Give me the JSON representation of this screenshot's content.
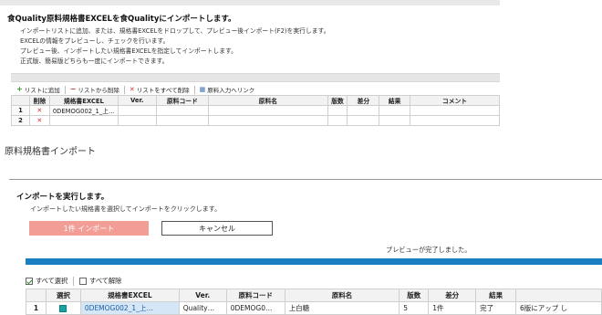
{
  "top_panel": {
    "title": "食Quality原料規格書EXCELを食Qualityにインポートします。",
    "instructions": [
      "インポートリストに追加、または、規格書EXCELをドロップして、プレビュー後インポート(F2)を実行します。",
      "EXCELの情報をプレビューし、チェックを行います。",
      "プレビュー後、インポートしたい規格書EXCELを指定してインポートします。",
      "正式版、簡易版どちらも一度にインポートできます。"
    ],
    "toolbar": {
      "add_label": "リストに追加",
      "remove_label": "リストから削除",
      "remove_all_label": "リストをすべて削除",
      "link_label": "原料入力へリンク"
    },
    "grid": {
      "columns": [
        "削除",
        "規格書EXCEL",
        "Ver.",
        "原料コード",
        "原料名",
        "版数",
        "差分",
        "結果",
        "コメント"
      ],
      "rows": [
        {
          "row_no": "1",
          "delete_mark": "✕",
          "file": "0DEMOG002_1_上…",
          "ver": "",
          "code": "",
          "name": "",
          "edition": "",
          "diff": "",
          "result": "",
          "comment": ""
        },
        {
          "row_no": "2",
          "delete_mark": "✕",
          "file": "",
          "ver": "",
          "code": "",
          "name": "",
          "edition": "",
          "diff": "",
          "result": "",
          "comment": ""
        }
      ]
    }
  },
  "section_title": "原料規格書インポート",
  "bottom_panel": {
    "title": "インポートを実行します。",
    "subtitle": "インポートしたい規格書を選択してインポートをクリックします。",
    "import_button": "1件 インポート",
    "cancel_button": "キャンセル",
    "preview_status": "プレビューが完了しました。",
    "toolbar": {
      "select_all_label": "すべて選択",
      "deselect_all_label": "すべて解除"
    },
    "grid": {
      "columns": [
        "選択",
        "規格書EXCEL",
        "Ver.",
        "原料コード",
        "原料名",
        "版数",
        "差分",
        "結果",
        ""
      ],
      "rows": [
        {
          "row_no": "1",
          "selected": true,
          "file": "0DEMOG002_1_上…",
          "ver": "Quality…",
          "code": "0DEMOG0…",
          "name": "上白糖",
          "edition": "5",
          "diff": "1件",
          "result": "完了",
          "note": "6版にアップ し"
        }
      ]
    }
  },
  "colors": {
    "import_button_bg": "#f29e97",
    "progress_bar": "#1a7fc1",
    "delete_mark": "#dd3333",
    "selected_file_cell": "#d5e6f7",
    "select_checkbox": "#16a3a3"
  }
}
